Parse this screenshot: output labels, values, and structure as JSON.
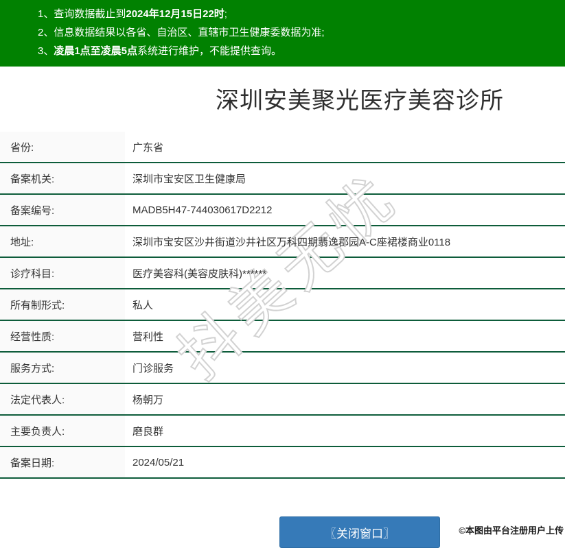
{
  "banner": {
    "bg_color": "#018101",
    "lines": [
      {
        "num": "1、",
        "pre": "查询数据截止到",
        "bold": "2024年12月15日22时",
        "post": ";"
      },
      {
        "num": "2、",
        "pre": "信息数据结果以各省、自治区、直辖市卫生健康委数据为准;",
        "bold": "",
        "post": ""
      },
      {
        "num": "3、",
        "pre": "",
        "bold": "凌晨1点至凌晨5点",
        "post": "系统进行维护，不能提供查询。"
      }
    ]
  },
  "title": "深圳安美聚光医疗美容诊所",
  "table": {
    "border_color": "#0d5c3a",
    "label_bg_color": "#fafafa",
    "rows": [
      {
        "label": "省份:",
        "value": "广东省"
      },
      {
        "label": "备案机关:",
        "value": "深圳市宝安区卫生健康局"
      },
      {
        "label": "备案编号:",
        "value": "MADB5H47-744030617D2212"
      },
      {
        "label": "地址:",
        "value": "深圳市宝安区沙井街道沙井社区万科四期翡逸郡园A-C座裙楼商业0118"
      },
      {
        "label": "诊疗科目:",
        "value": "医疗美容科(美容皮肤科)******"
      },
      {
        "label": "所有制形式:",
        "value": "私人"
      },
      {
        "label": "经营性质:",
        "value": "营利性"
      },
      {
        "label": "服务方式:",
        "value": "门诊服务"
      },
      {
        "label": "法定代表人:",
        "value": "杨朝万"
      },
      {
        "label": "主要负责人:",
        "value": "磨良群"
      },
      {
        "label": "备案日期:",
        "value": "2024/05/21"
      }
    ]
  },
  "watermark_text": "抖美无忧",
  "close_button_label": "〖关闭窗口〗",
  "close_button_color": "#367ab8",
  "uploader_note": "©本图由平台注册用户上传"
}
